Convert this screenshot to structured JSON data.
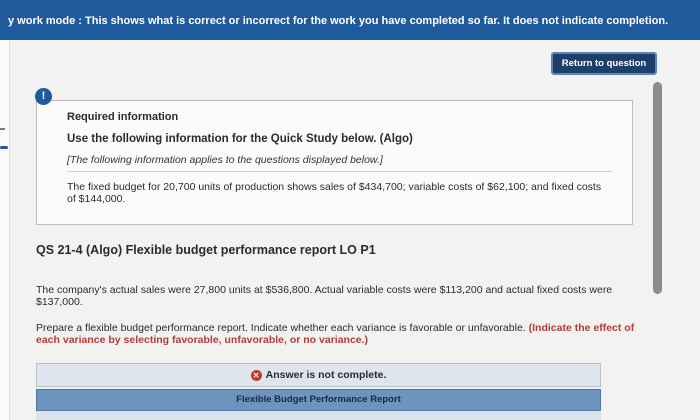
{
  "banner": {
    "mode_label": "y work mode : This shows what is correct or incorrect for the work you have completed so far. It does not indicate completion."
  },
  "buttons": {
    "return_label": "Return to question"
  },
  "alert": {
    "symbol": "!"
  },
  "info": {
    "required_heading": "Required information",
    "use_line": "Use the following information for the Quick Study below. (Algo)",
    "applies_line": "[The following information applies to the questions displayed below.]",
    "budget_text": "The fixed budget for 20,700 units of production shows sales of $434,700; variable costs of $62,100; and fixed costs of $144,000."
  },
  "question": {
    "title": "QS 21-4 (Algo) Flexible budget performance report LO P1",
    "actual_text": "The company's actual sales were 27,800 units at $536,800. Actual variable costs were $113,200 and actual fixed costs were $137,000.",
    "prepare_text": "Prepare a flexible budget performance report. Indicate whether each variance is favorable or unfavorable.",
    "prepare_bold": "(Indicate the effect of each variance by selecting favorable, unfavorable, or no variance.)"
  },
  "answer": {
    "status_text": "Answer is not complete.",
    "status_icon": "x-circle-icon"
  },
  "report": {
    "tab_label": "Flexible Budget Performance Report"
  },
  "colors": {
    "banner": "#1f5b9c",
    "button": "#1f3f6b",
    "error": "#c0392b",
    "tab": "#6d93bf"
  }
}
